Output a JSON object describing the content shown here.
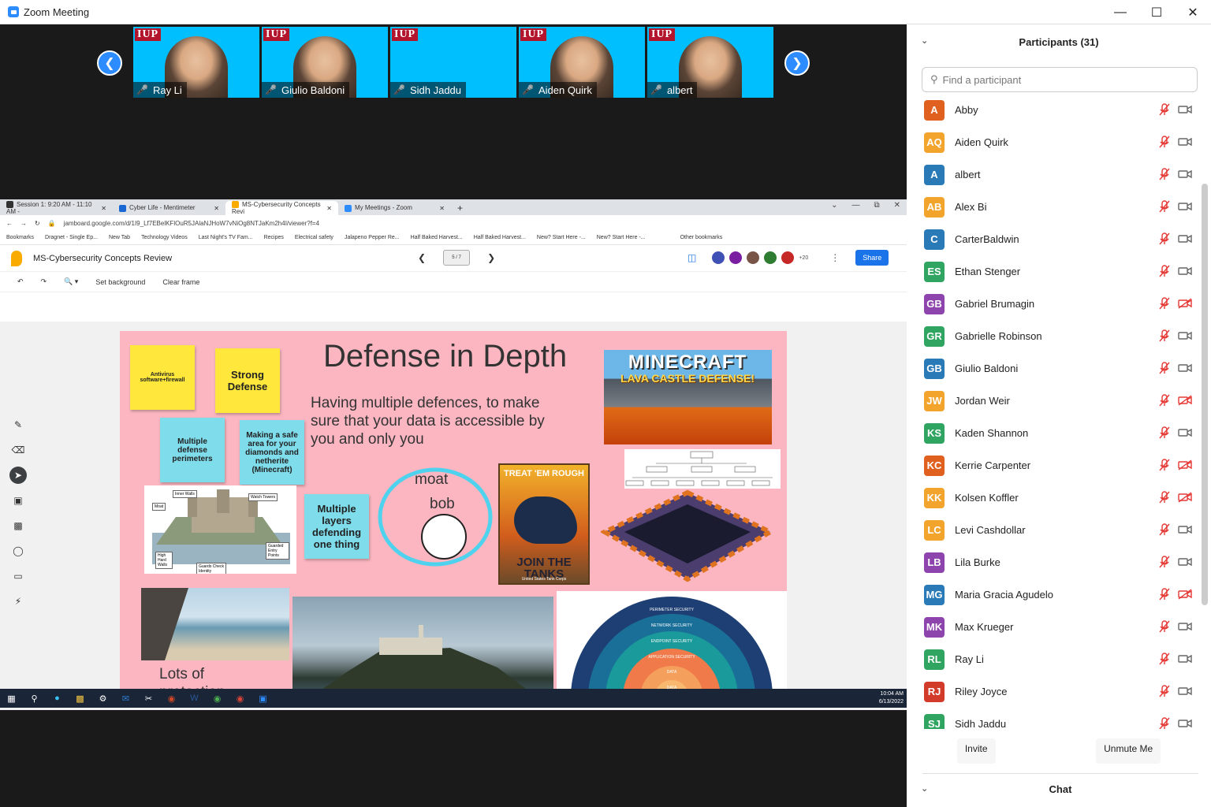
{
  "window": {
    "title": "Zoom Meeting"
  },
  "gallery": {
    "tiles": [
      {
        "name": "Ray Li"
      },
      {
        "name": "Giulio Baldoni"
      },
      {
        "name": "Sidh Jaddu"
      },
      {
        "name": "Aiden Quirk"
      },
      {
        "name": "albert"
      }
    ],
    "logo_text": "IUP"
  },
  "browser": {
    "tabs": [
      {
        "label": "Session 1: 9:20 AM - 11:10 AM -",
        "color": "#333333"
      },
      {
        "label": "Cyber Life - Mentimeter",
        "color": "#1967d2"
      },
      {
        "label": "MS-Cybersecurity Concepts Revi",
        "color": "#f9ab00"
      },
      {
        "label": "My Meetings - Zoom",
        "color": "#2d8cff"
      }
    ],
    "url": "jamboard.google.com/d/1I9_Lf7EBelKFlOuR5JAlaNJHoW7vNiOg8NTJaKm2h4I/viewer?f=4",
    "bookmarks": [
      "Bookmarks",
      "Dragnet - Single Ep...",
      "New Tab",
      "Technology Videos",
      "Last Night's TV Fam...",
      "Recipes",
      "Electrical safety",
      "Jalapeno Pepper Re...",
      "Half Baked Harvest...",
      "Half Baked Harvest...",
      "New? Start Here -...",
      "New? Start Here -..."
    ],
    "other_bookmarks": "Other bookmarks"
  },
  "jamboard": {
    "title": "MS-Cybersecurity Concepts Review",
    "frame_counter": "5 / 7",
    "collaborators_more": "+20",
    "share_label": "Share",
    "toolbar": {
      "set_background": "Set background",
      "clear_frame": "Clear frame"
    }
  },
  "board": {
    "title": "Defense in Depth",
    "subtitle": "Having multiple defences, to make sure that your data is accessible by you and only you",
    "stickies": {
      "antivirus": "Antivirus software+firewall",
      "strong": "Strong Defense",
      "perimeters": "Multiple defense perimeters",
      "safe_area": "Making a safe area for your diamonds and netherite (Minecraft)",
      "layers": "Multiple layers defending one thing"
    },
    "labels": {
      "moat": "moat",
      "bob": "bob",
      "protection": "Lots of protection"
    },
    "castle_labels": [
      "Inner Walls",
      "Watch Towers",
      "Moat",
      "High Hard Walls",
      "Guards Check Identity",
      "Guarded Entry Points"
    ],
    "minecraft_text": {
      "line1": "MINECRAFT",
      "line2": "LAVA CASTLE DEFENSE!"
    },
    "poster_text": {
      "top": "TREAT 'EM ROUGH",
      "bottom": "JOIN THE TANKS",
      "footer": "United States Tank Corps"
    },
    "rainbow_layers": [
      "PERIMETER SECURITY",
      "NETWORK SECURITY",
      "ENDPOINT SECURITY",
      "APPLICATION SECURITY",
      "DATA",
      "DATA"
    ]
  },
  "taskbar": {
    "time": "10:04 AM",
    "date": "6/13/2022"
  },
  "participants": {
    "header": "Participants (31)",
    "search_placeholder": "Find a participant",
    "list": [
      {
        "initials": "A",
        "name": "Abby",
        "color": "#e0601f",
        "video_off": false
      },
      {
        "initials": "AQ",
        "name": "Aiden Quirk",
        "color": "#f3a42d",
        "video_off": false
      },
      {
        "initials": "A",
        "name": "albert",
        "color": "#2a7ab8",
        "video_off": false
      },
      {
        "initials": "AB",
        "name": "Alex Bi",
        "color": "#f3a42d",
        "video_off": false
      },
      {
        "initials": "C",
        "name": "CarterBaldwin",
        "color": "#2a7ab8",
        "video_off": false
      },
      {
        "initials": "ES",
        "name": "Ethan Stenger",
        "color": "#2fa561",
        "video_off": false
      },
      {
        "initials": "GB",
        "name": "Gabriel Brumagin",
        "color": "#8e44ad",
        "video_off": true
      },
      {
        "initials": "GR",
        "name": "Gabrielle Robinson",
        "color": "#2fa561",
        "video_off": false
      },
      {
        "initials": "GB",
        "name": "Giulio Baldoni",
        "color": "#2a7ab8",
        "video_off": false
      },
      {
        "initials": "JW",
        "name": "Jordan Weir",
        "color": "#f3a42d",
        "video_off": true
      },
      {
        "initials": "KS",
        "name": "Kaden Shannon",
        "color": "#2fa561",
        "video_off": false
      },
      {
        "initials": "KC",
        "name": "Kerrie Carpenter",
        "color": "#e0601f",
        "video_off": true
      },
      {
        "initials": "KK",
        "name": "Kolsen Koffler",
        "color": "#f3a42d",
        "video_off": true
      },
      {
        "initials": "LC",
        "name": "Levi Cashdollar",
        "color": "#f3a42d",
        "video_off": false
      },
      {
        "initials": "LB",
        "name": "Lila Burke",
        "color": "#8e44ad",
        "video_off": false
      },
      {
        "initials": "MG",
        "name": "Maria Gracia Agudelo",
        "color": "#2a7ab8",
        "video_off": true
      },
      {
        "initials": "MK",
        "name": "Max Krueger",
        "color": "#8e44ad",
        "video_off": false
      },
      {
        "initials": "RL",
        "name": "Ray Li",
        "color": "#2fa561",
        "video_off": false
      },
      {
        "initials": "RJ",
        "name": "Riley Joyce",
        "color": "#d23a2a",
        "video_off": false
      },
      {
        "initials": "SJ",
        "name": "Sidh Jaddu",
        "color": "#2fa561",
        "video_off": false
      }
    ],
    "invite_label": "Invite",
    "unmute_label": "Unmute Me"
  },
  "chat": {
    "header": "Chat"
  }
}
